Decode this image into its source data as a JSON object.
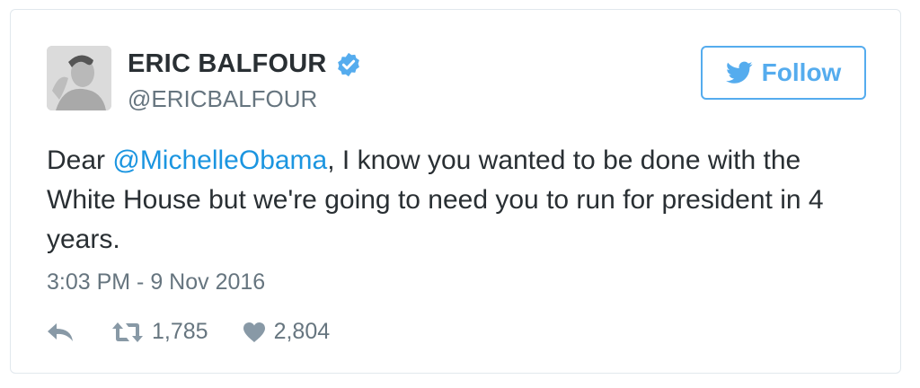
{
  "tweet": {
    "author": {
      "name": "ERIC BALFOUR",
      "handle": "@ERICBALFOUR",
      "verified": true,
      "avatar_icon": "profile-photo"
    },
    "follow_label": "Follow",
    "text": {
      "prefix": "Dear ",
      "mention": "@MichelleObama",
      "suffix": ", I know you wanted to be done with the White House but we're going to need you to run for president in 4 years."
    },
    "timestamp": "3:03 PM - 9 Nov 2016",
    "stats": {
      "retweets": "1,785",
      "likes": "2,804"
    }
  },
  "colors": {
    "accent": "#55acee",
    "mention": "#1b95e0",
    "text": "#292f33",
    "muted": "#66757f",
    "icon": "#8899a6"
  }
}
